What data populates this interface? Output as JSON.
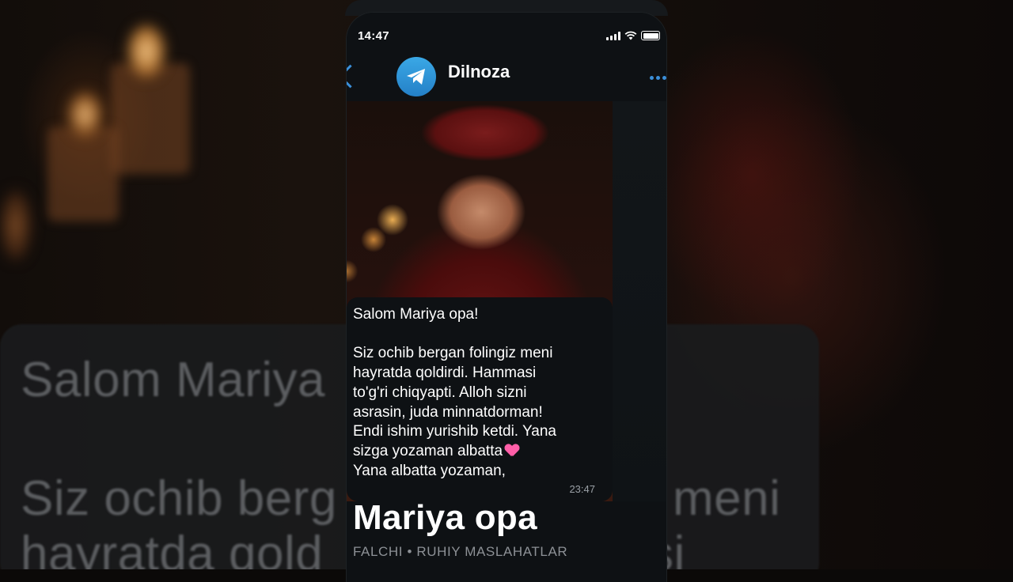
{
  "status_bar": {
    "time": "14:47"
  },
  "chat": {
    "contact_name": "Dilnoza",
    "message": {
      "lines": [
        "Salom Mariya opa!",
        "",
        "Siz ochib bergan folingiz meni",
        "hayratda qoldirdi. Hammasi",
        "to'g'ri chiqyapti. Alloh sizni",
        "asrasin, juda minnatdorman!",
        "Endi ishim yurishib ketdi. Yana",
        "sizga yozaman albatta",
        "Yana albatta yozaman,"
      ],
      "time": "23:47"
    }
  },
  "overlay": {
    "title": "Mariya opa",
    "subtitle": "FALCHI • RUHIY MASLAHATLAR"
  },
  "background": {
    "line1": "Salom Mariya",
    "line2": "Siz ochib berg",
    "line2_right": "meni",
    "line3": "hayratda qold",
    "line3_right": "si"
  }
}
